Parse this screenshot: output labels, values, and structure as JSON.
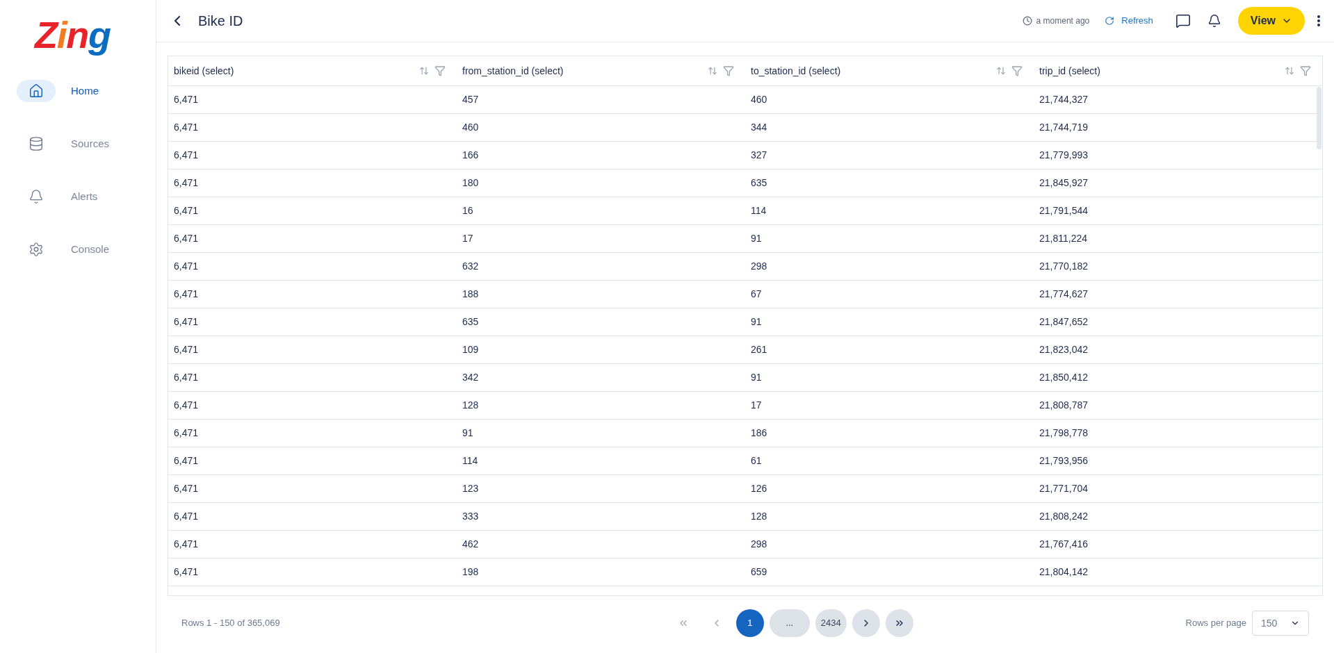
{
  "logo": "Zing",
  "sidebar": {
    "items": [
      {
        "label": "Home",
        "kind": "home",
        "selected": true
      },
      {
        "label": "Sources",
        "kind": "sources",
        "selected": false
      },
      {
        "label": "Alerts",
        "kind": "alerts",
        "selected": false
      },
      {
        "label": "Console",
        "kind": "console",
        "selected": false
      }
    ]
  },
  "header": {
    "title": "Bike ID",
    "updated": "a moment ago",
    "refresh": "Refresh",
    "view_button": "View"
  },
  "table": {
    "columns": [
      "bikeid (select)",
      "from_station_id (select)",
      "to_station_id (select)",
      "trip_id (select)"
    ],
    "rows": [
      [
        "6,471",
        "457",
        "460",
        "21,744,327"
      ],
      [
        "6,471",
        "460",
        "344",
        "21,744,719"
      ],
      [
        "6,471",
        "166",
        "327",
        "21,779,993"
      ],
      [
        "6,471",
        "180",
        "635",
        "21,845,927"
      ],
      [
        "6,471",
        "16",
        "114",
        "21,791,544"
      ],
      [
        "6,471",
        "17",
        "91",
        "21,811,224"
      ],
      [
        "6,471",
        "632",
        "298",
        "21,770,182"
      ],
      [
        "6,471",
        "188",
        "67",
        "21,774,627"
      ],
      [
        "6,471",
        "635",
        "91",
        "21,847,652"
      ],
      [
        "6,471",
        "109",
        "261",
        "21,823,042"
      ],
      [
        "6,471",
        "342",
        "91",
        "21,850,412"
      ],
      [
        "6,471",
        "128",
        "17",
        "21,808,787"
      ],
      [
        "6,471",
        "91",
        "186",
        "21,798,778"
      ],
      [
        "6,471",
        "114",
        "61",
        "21,793,956"
      ],
      [
        "6,471",
        "123",
        "126",
        "21,771,704"
      ],
      [
        "6,471",
        "333",
        "128",
        "21,808,242"
      ],
      [
        "6,471",
        "462",
        "298",
        "21,767,416"
      ],
      [
        "6,471",
        "198",
        "659",
        "21,804,142"
      ]
    ]
  },
  "pagination": {
    "summary": "Rows 1 - 150 of 365,069",
    "pages": [
      {
        "label": "1",
        "selected": true
      },
      {
        "label": "...",
        "selected": false
      },
      {
        "label": "2434",
        "selected": false
      }
    ],
    "rows_per_page_label": "Rows per page",
    "rows_per_page": "150"
  }
}
